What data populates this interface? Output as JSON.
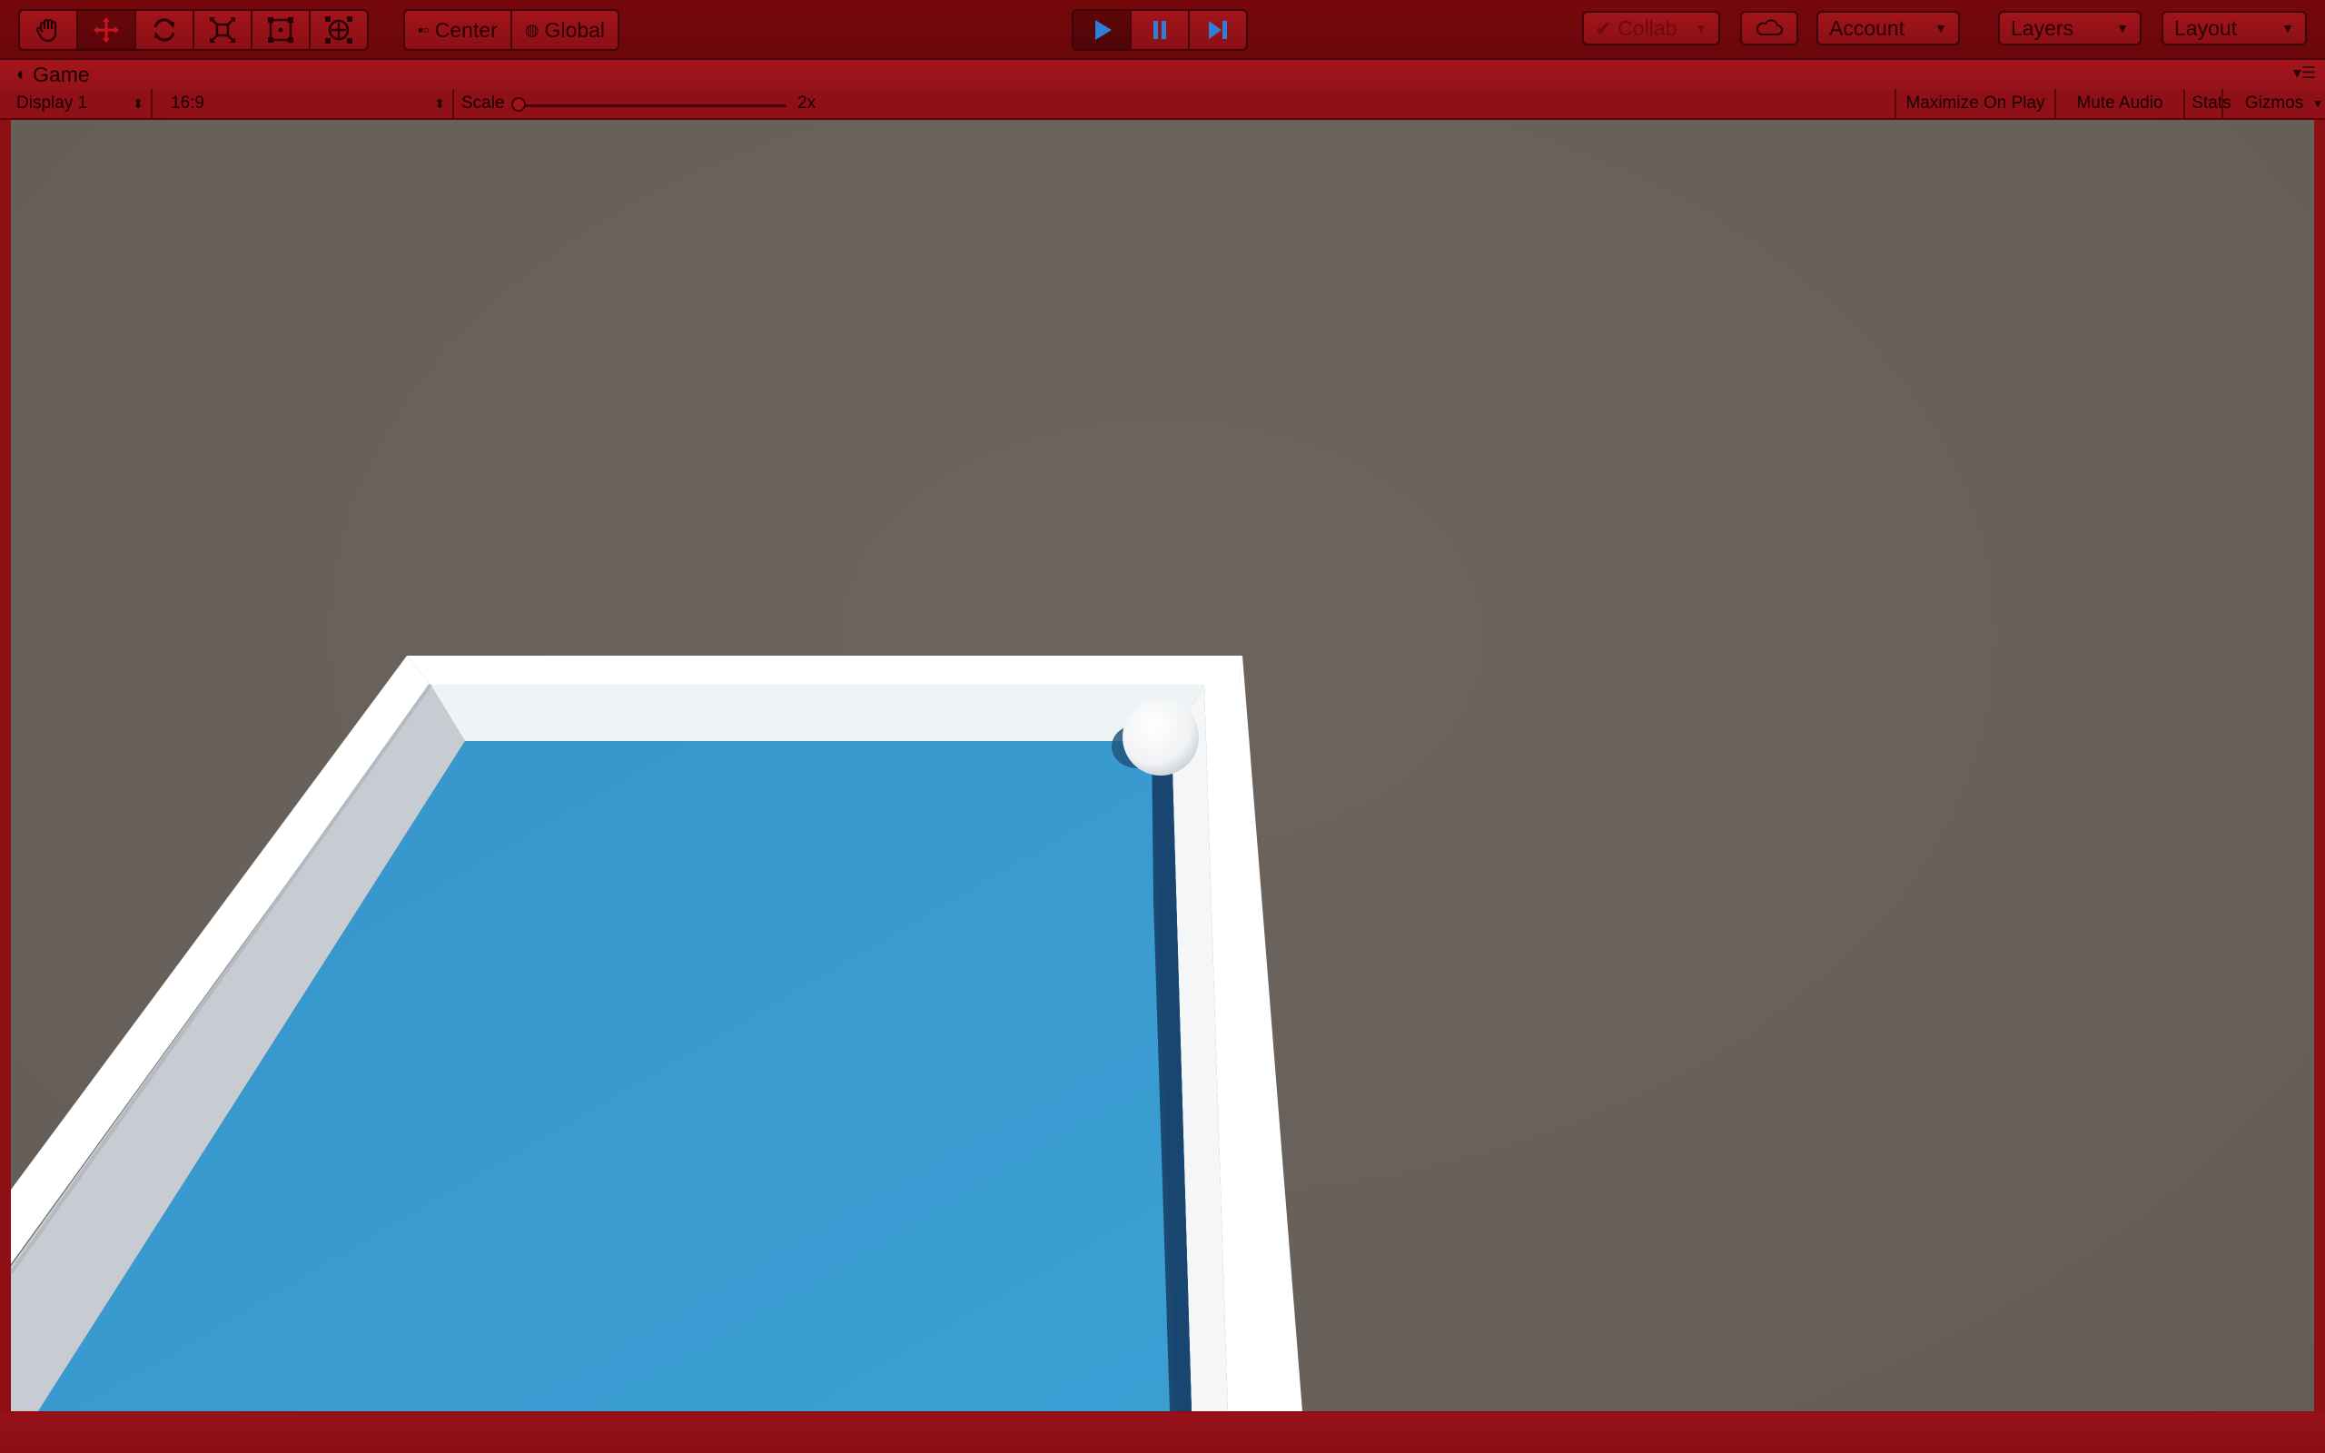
{
  "toolbar": {
    "transform_tools": [
      {
        "name": "hand-tool-button",
        "icon": "hand-icon",
        "active": false
      },
      {
        "name": "move-tool-button",
        "icon": "move-arrows-icon",
        "active": true
      },
      {
        "name": "rotate-tool-button",
        "icon": "rotate-icon",
        "active": false
      },
      {
        "name": "scale-tool-button",
        "icon": "scale-icon",
        "active": false
      },
      {
        "name": "rect-tool-button",
        "icon": "rect-transform-icon",
        "active": false
      },
      {
        "name": "transform-tool-button",
        "icon": "combined-transform-icon",
        "active": false
      }
    ],
    "pivot_mode_label": "Center",
    "pivot_rotation_label": "Global",
    "play_state": {
      "playing": true,
      "paused": false
    },
    "collab_label": "Collab",
    "account_label": "Account",
    "layers_label": "Layers",
    "layout_label": "Layout",
    "cloud_icon": "cloud-icon"
  },
  "game_view": {
    "tab_title": "Game",
    "tab_icon": "pacman-icon",
    "display_label": "Display 1",
    "aspect_label": "16:9",
    "scale_label": "Scale",
    "scale_value": "2x",
    "scale_fraction": 0.0,
    "maximize_label": "Maximize On Play",
    "mute_label": "Mute Audio",
    "stats_label": "Stats",
    "gizmos_label": "Gizmos"
  },
  "colors": {
    "playmode_tint": "#8e0f14",
    "toolbar_bg": "#76080c",
    "scene_background": "#68605a",
    "floor_blue": "#3a9bd0",
    "wall_white": "#ffffff",
    "wall_shadow_blue": "#1a4a72"
  }
}
